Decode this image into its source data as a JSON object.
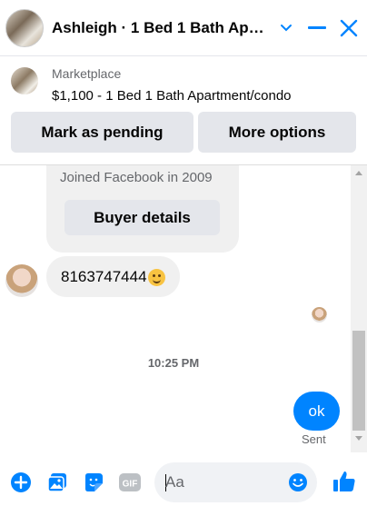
{
  "header": {
    "title": "Ashleigh · 1 Bed 1 Bath Ap…",
    "icons": [
      "chevron-down-icon",
      "minimize-icon",
      "close-icon"
    ]
  },
  "listing": {
    "label": "Marketplace",
    "title": "$1,100 - 1 Bed 1 Bath Apartment/condo",
    "buttons": [
      "Mark as pending",
      "More options"
    ]
  },
  "chat": {
    "profile_card": {
      "joined_text": "Joined Facebook in 2009",
      "button_label": "Buyer details"
    },
    "incoming_message": "8163747444",
    "timestamp": "10:25 PM",
    "outgoing_message": "ok",
    "status": "Sent"
  },
  "composer": {
    "placeholder": "Aa",
    "icons": [
      "add-icon",
      "photo-icon",
      "sticker-icon",
      "gif-icon",
      "emoji-icon",
      "like-icon"
    ]
  },
  "colors": {
    "accent": "#0084ff",
    "bubble_gray": "#f0f0f0",
    "button_gray": "#e4e6eb",
    "secondary_text": "#65676b"
  }
}
